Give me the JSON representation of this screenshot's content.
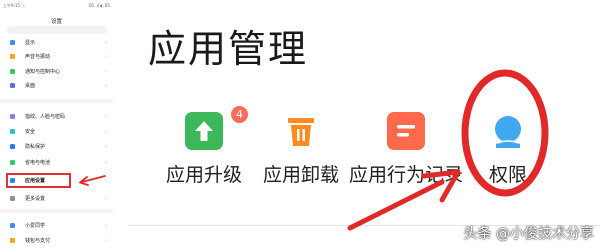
{
  "phone": {
    "status_left": "上午9:15 ⓘ",
    "status_right": "5G .ıl ◐ 85",
    "title": "设置",
    "menu": [
      {
        "label": "显示",
        "color": "#3d8bff"
      },
      {
        "label": "声音与振动",
        "color": "#f5a623"
      },
      {
        "label": "通知与控制中心",
        "color": "#34c759"
      },
      {
        "label": "桌面",
        "color": "#5b6cff"
      },
      {
        "label": "指纹、人脸与密码",
        "color": "#a070ff"
      },
      {
        "label": "安全",
        "color": "#2ec4b6"
      },
      {
        "label": "隐私保护",
        "color": "#1f7bff"
      },
      {
        "label": "省电与电池",
        "color": "#39c469"
      },
      {
        "label": "应用设置",
        "color": "#2f80ff"
      },
      {
        "label": "更多设置",
        "color": "#8e8e93"
      },
      {
        "label": "小爱同学",
        "color": "#3d8bff"
      },
      {
        "label": "钱包与支付",
        "color": "#f5a623"
      }
    ]
  },
  "main": {
    "title": "应用管理",
    "tiles": [
      {
        "label": "应用升级",
        "badge": "4",
        "icon": "upgrade-icon",
        "color": "#3cb85a"
      },
      {
        "label": "应用卸载",
        "icon": "trash-icon",
        "color": "#ff8a1f"
      },
      {
        "label": "应用行为记录",
        "icon": "record-icon",
        "color": "#ff6a4d"
      },
      {
        "label": "权限",
        "icon": "permission-icon",
        "color": "#41a8f0"
      }
    ]
  },
  "watermark": "头条 @小俊技术分享",
  "colors": {
    "annotation": "#e02a2a"
  }
}
